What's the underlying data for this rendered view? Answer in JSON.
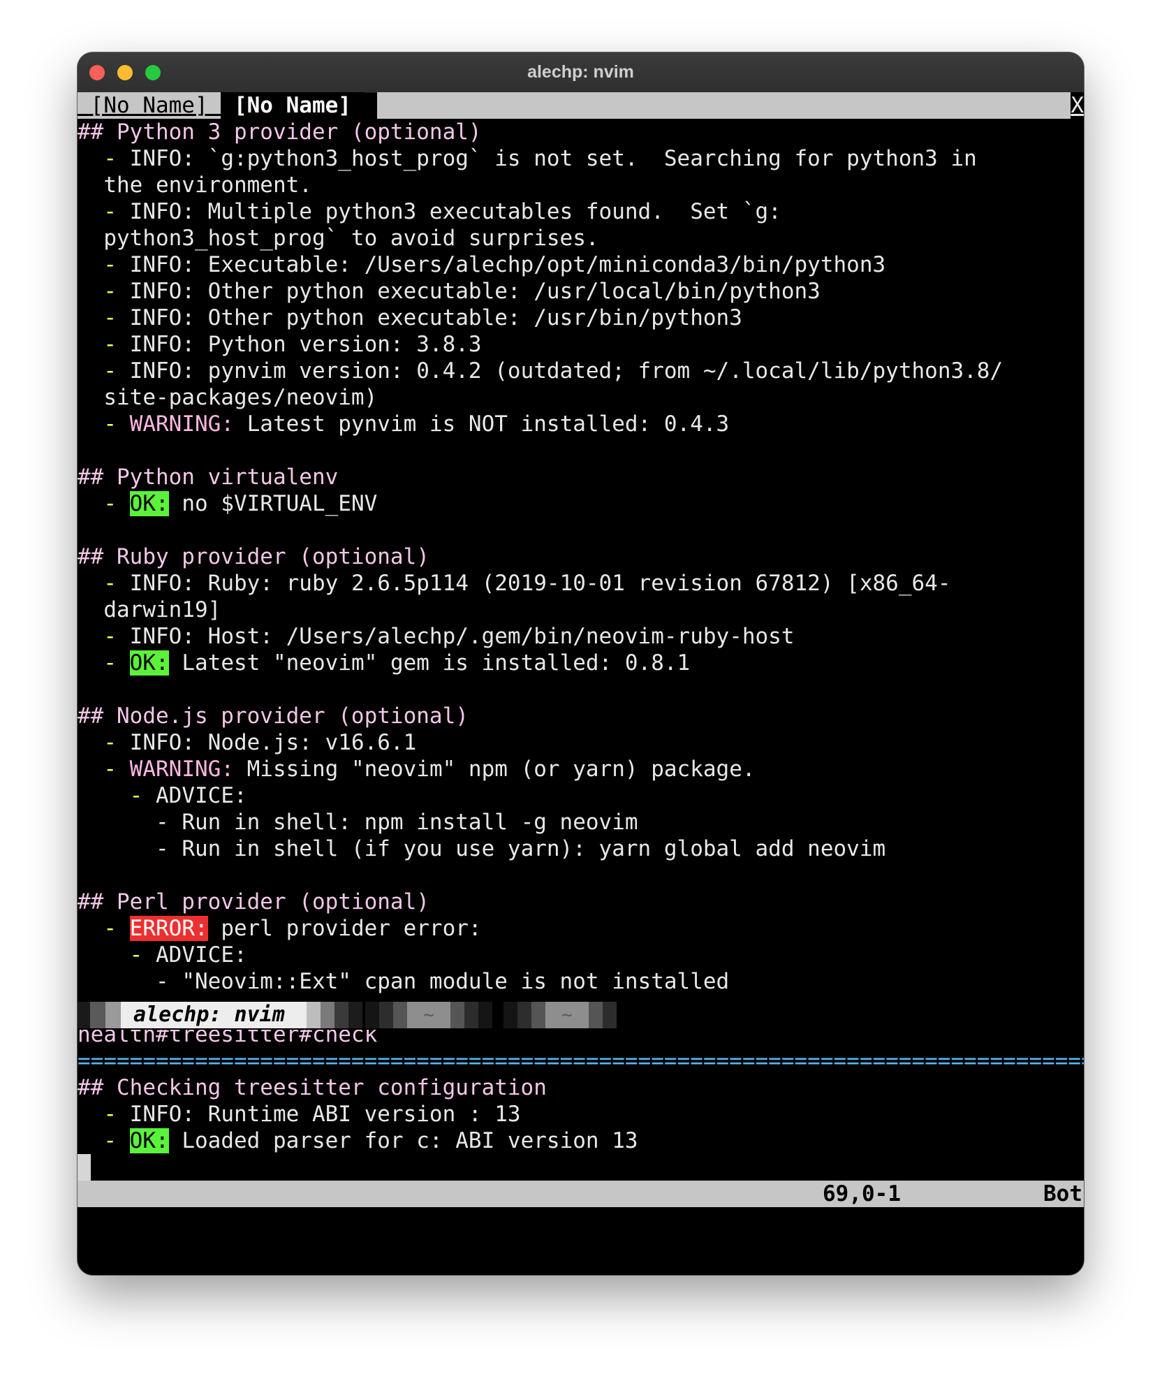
{
  "window": {
    "title": "alechp: nvim"
  },
  "tabline": {
    "inactive_tab": " [No Name] ",
    "active_tab": " [No Name] ",
    "close": "X"
  },
  "lines": {
    "l1_head": "## Python 3 provider (optional)",
    "l2a": "INFO: `g:python3_host_prog` is not set.  Searching for python3 in",
    "l2b": "the environment.",
    "l3a": "INFO: Multiple python3 executables found.  Set `g:",
    "l3b": "python3_host_prog` to avoid surprises.",
    "l4": "INFO: Executable: /Users/alechp/opt/miniconda3/bin/python3",
    "l5": "INFO: Other python executable: /usr/local/bin/python3",
    "l6": "INFO: Other python executable: /usr/bin/python3",
    "l7": "INFO: Python version: 3.8.3",
    "l8a": "INFO: pynvim version: 0.4.2 (outdated; from ~/.local/lib/python3.8/",
    "l8b": "site-packages/neovim)",
    "l9_label": "WARNING:",
    "l9_text": " Latest pynvim is NOT installed: 0.4.3",
    "venv_head": "## Python virtualenv",
    "venv_ok": "OK:",
    "venv_text": " no $VIRTUAL_ENV",
    "ruby_head": "## Ruby provider (optional)",
    "ruby1a": "INFO: Ruby: ruby 2.6.5p114 (2019-10-01 revision 67812) [x86_64-",
    "ruby1b": "darwin19]",
    "ruby2": "INFO: Host: /Users/alechp/.gem/bin/neovim-ruby-host",
    "ruby3_ok": "OK:",
    "ruby3_text": " Latest \"neovim\" gem is installed: 0.8.1",
    "node_head": "## Node.js provider (optional)",
    "node1": "INFO: Node.js: v16.6.1",
    "node2_label": "WARNING:",
    "node2_text": " Missing \"neovim\" npm (or yarn) package.",
    "node_advice": "ADVICE:",
    "node_adv1": "Run in shell: npm install -g neovim",
    "node_adv2": "Run in shell (if you use yarn): yarn global add neovim",
    "perl_head": "## Perl provider (optional)",
    "perl_err": "ERROR:",
    "perl_err_text": " perl provider error:",
    "perl_advice": "ADVICE:",
    "perl_adv1": "\"Neovim::Ext\" cpan module is not installed",
    "ts_check": "health#treesitter#check",
    "separator": "========================================================================================================================",
    "ts_head": "## Checking treesitter configuration",
    "ts1": "INFO: Runtime ABI version : 13",
    "ts2_ok": "OK:",
    "ts2_text": " Loaded parser for c: ABI version 13"
  },
  "statusline": {
    "name": "[No Name]",
    "position": "69,0-1",
    "scroll": "Bot"
  },
  "tmux": {
    "active_window": " alechp: nvim",
    "tilde_1": "~",
    "tilde_2": "~"
  },
  "colors": {
    "heading": "#f2c6e7",
    "bullet": "#fcff55",
    "warning": "#ffb7e3",
    "ok_bg": "#5bf23a",
    "error_bg": "#ef2f2f",
    "separator": "#56b8f0"
  }
}
